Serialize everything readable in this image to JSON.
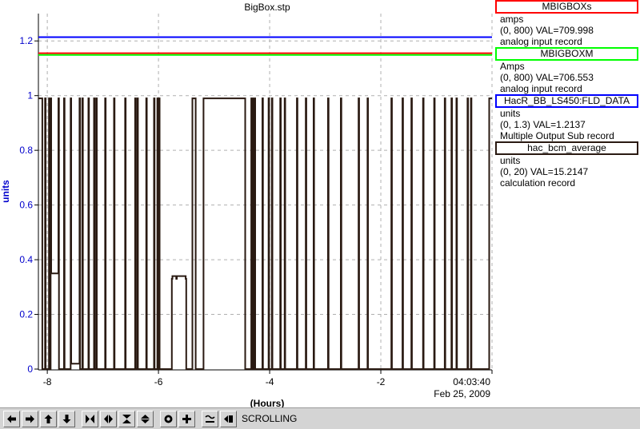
{
  "chart_data": {
    "type": "line",
    "title": "BigBox.stp",
    "xlabel": "(Hours)",
    "ylabel": "units",
    "xlim": [
      -8.16,
      0.0
    ],
    "ylim": [
      0,
      1.3
    ],
    "x_ticks": [
      -8,
      -6,
      -4,
      -2
    ],
    "x_tick_labels": [
      "-8",
      "-6",
      "-4",
      "-2"
    ],
    "y_ticks": [
      0,
      0.2,
      0.4,
      0.6,
      0.8,
      1,
      1.2
    ],
    "y_tick_labels": [
      "0",
      "0.2",
      "0.4",
      "0.6",
      "0.8",
      "1",
      "1.2"
    ],
    "time_label": "04:03:40",
    "date_label": "Feb 25, 2009",
    "grid": true,
    "series": [
      {
        "name": "MBIGBOXs",
        "color": "#ff0000",
        "x": [
          -8.16,
          0.0
        ],
        "y": [
          1.155,
          1.155
        ]
      },
      {
        "name": "MBIGBOXM",
        "color": "#00ff00",
        "x": [
          -8.16,
          0.0
        ],
        "y": [
          1.149,
          1.149
        ]
      },
      {
        "name": "HacR_BB_LS450:FLD_DATA",
        "color": "#0000ff",
        "x": [
          -8.16,
          0.0
        ],
        "y": [
          1.2137,
          1.2137
        ]
      },
      {
        "name": "hac_bcm_average",
        "color": "#2a1a12",
        "x": [
          -8.16,
          -8.1,
          -8.09,
          -8.04,
          -8.03,
          -7.97,
          -7.96,
          -7.94,
          -7.93,
          -7.8,
          -7.79,
          -7.7,
          -7.69,
          -7.58,
          -7.57,
          -7.42,
          -7.41,
          -7.37,
          -7.36,
          -7.26,
          -7.25,
          -7.16,
          -7.15,
          -7.12,
          -7.11,
          -6.96,
          -6.95,
          -6.8,
          -6.79,
          -6.6,
          -6.59,
          -6.42,
          -6.41,
          -6.38,
          -6.37,
          -6.22,
          -6.21,
          -6.08,
          -6.07,
          -6.02,
          -6.01,
          -5.99,
          -5.98,
          -5.76,
          -5.75,
          -5.68,
          -5.67,
          -5.51,
          -5.5,
          -5.4,
          -5.39,
          -5.34,
          -5.33,
          -5.2,
          -5.19,
          -4.45,
          -4.44,
          -4.33,
          -4.32,
          -4.3,
          -4.29,
          -4.27,
          -4.26,
          -4.13,
          -4.12,
          -4.02,
          -4.01,
          -3.96,
          -3.95,
          -3.81,
          -3.8,
          -3.73,
          -3.72,
          -3.51,
          -3.5,
          -3.35,
          -3.34,
          -3.21,
          -3.2,
          -2.95,
          -2.94,
          -2.72,
          -2.71,
          -2.4,
          -2.39,
          -2.24,
          -2.23,
          -1.81,
          -1.8,
          -1.61,
          -1.6,
          -1.45,
          -1.44,
          -1.24,
          -1.23,
          -1.04,
          -1.03,
          -0.85,
          -0.84,
          -0.73,
          -0.72,
          -0.64,
          -0.63,
          -0.44,
          -0.43,
          -0.38,
          -0.37,
          -0.05,
          0.0
        ],
        "y": [
          0.99,
          0.99,
          0.0,
          0.99,
          0.0,
          0.99,
          0.0,
          0.99,
          0.35,
          0.99,
          0.0,
          0.99,
          0.0,
          0.99,
          0.02,
          0.99,
          0.0,
          0.99,
          0.0,
          0.99,
          0.0,
          0.99,
          0.0,
          0.99,
          0.0,
          0.99,
          0.0,
          0.99,
          0.0,
          0.99,
          0.0,
          0.99,
          0.0,
          0.99,
          0.0,
          0.99,
          0.0,
          0.99,
          0.0,
          0.99,
          0.0,
          0.99,
          0.0,
          0.33,
          0.34,
          0.33,
          0.34,
          0.33,
          0.0,
          0.0,
          0.99,
          0.99,
          0.0,
          0.0,
          0.99,
          0.99,
          0.0,
          0.99,
          0.0,
          0.99,
          0.0,
          0.99,
          0.0,
          0.99,
          0.0,
          0.99,
          0.0,
          0.99,
          0.0,
          0.99,
          0.0,
          0.99,
          0.0,
          0.99,
          0.0,
          0.99,
          0.0,
          0.99,
          0.0,
          0.99,
          0.0,
          0.99,
          0.0,
          0.99,
          0.0,
          0.99,
          0.0,
          0.99,
          0.0,
          0.99,
          0.0,
          0.99,
          0.0,
          0.99,
          0.0,
          0.99,
          0.0,
          0.99,
          0.0,
          0.99,
          0.0,
          0.99,
          0.0,
          0.99,
          0.0,
          0.99,
          0.0,
          0.99,
          0.99
        ]
      }
    ]
  },
  "channels": [
    {
      "name": "MBIGBOXs",
      "color": "#ff0000",
      "units": "amps",
      "range_value": "(0, 800) VAL=709.998",
      "record_type": "analog input record"
    },
    {
      "name": "MBIGBOXM",
      "color": "#00ff00",
      "units": "Amps",
      "range_value": "(0, 800) VAL=706.553",
      "record_type": "analog input record"
    },
    {
      "name": "HacR_BB_LS450:FLD_DATA",
      "color": "#0000ff",
      "units": "units",
      "range_value": "(0, 1.3) VAL=1.2137",
      "record_type": "Multiple Output Sub record"
    },
    {
      "name": "hac_bcm_average",
      "color": "#2a1a12",
      "units": "units",
      "range_value": "(0, 20) VAL=15.2147",
      "record_type": "calculation record"
    }
  ],
  "toolbar": {
    "buttons": [
      "arrow-left-icon",
      "arrow-right-icon",
      "arrow-up-icon",
      "arrow-down-icon",
      "zoom-in-horizontal-icon",
      "zoom-out-horizontal-icon",
      "zoom-in-vertical-icon",
      "zoom-out-vertical-icon",
      "autoscale-icon",
      "crosshair-icon",
      "trend-icon",
      "snapshot-icon"
    ],
    "status": "SCROLLING"
  }
}
